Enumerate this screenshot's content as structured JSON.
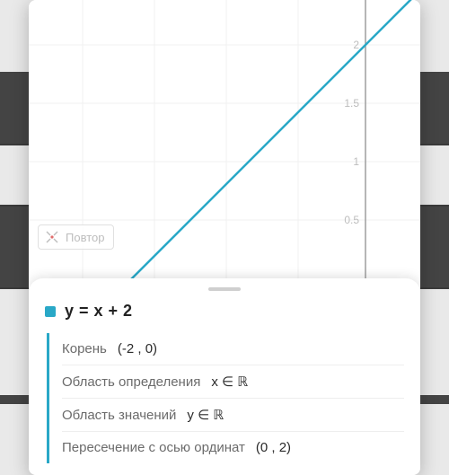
{
  "chart_data": {
    "type": "line",
    "title": "",
    "xlabel": "",
    "ylabel": "",
    "xlim": [
      -2.2,
      0.4
    ],
    "ylim": [
      0,
      2.4
    ],
    "y_ticks": [
      0.5,
      1,
      1.5,
      2
    ],
    "series": [
      {
        "name": "y = x + 2",
        "color": "#29a8c7",
        "x": [
          -2.2,
          0.4
        ],
        "y": [
          -0.2,
          2.4
        ]
      }
    ]
  },
  "reset_button": {
    "label": "Повтор"
  },
  "equation": {
    "display": "y = x + 2",
    "color": "#29a8c7"
  },
  "properties": [
    {
      "label": "Корень",
      "value": "(-2 , 0)"
    },
    {
      "label": "Область определения",
      "value": "x ∈ ℝ"
    },
    {
      "label": "Область значений",
      "value": "y ∈ ℝ"
    },
    {
      "label": "Пересечение с осью ординат",
      "value": "(0 , 2)"
    }
  ],
  "axis_labels": {
    "t05": "0.5",
    "t1": "1",
    "t15": "1.5",
    "t2": "2"
  }
}
